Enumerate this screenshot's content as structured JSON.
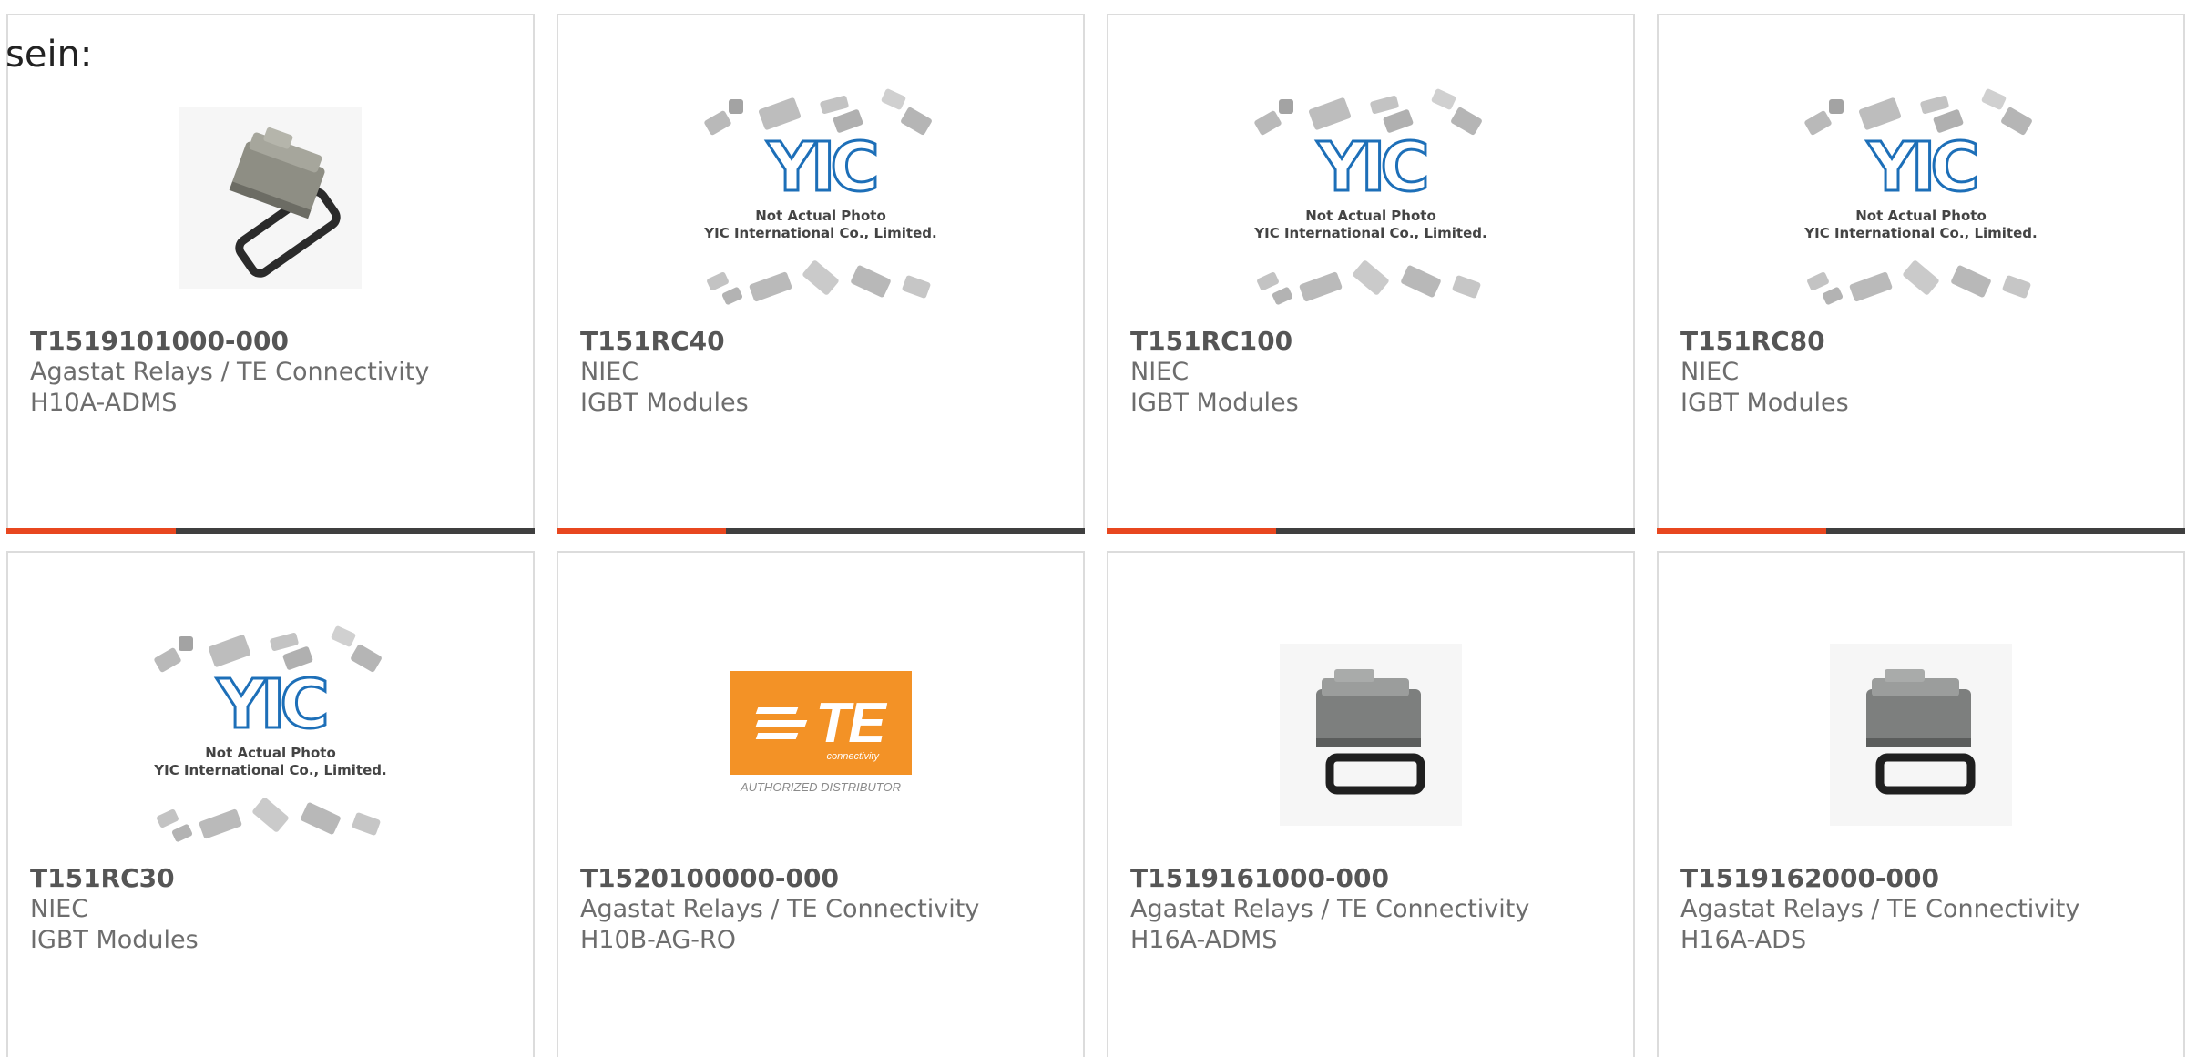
{
  "intro_text": "sein:",
  "colors": {
    "progress_accent": "#e8471f",
    "progress_track": "#3f3f3f",
    "te_orange": "#f39226",
    "yic_blue": "#1d6fb8"
  },
  "products": [
    {
      "part_number": "T1519101000-000",
      "manufacturer": "Agastat Relays / TE Connectivity",
      "category": "H10A-ADMS",
      "image_type": "connector-housing-photo",
      "progress": 0.32
    },
    {
      "part_number": "T151RC40",
      "manufacturer": "NIEC",
      "category": "IGBT Modules",
      "image_type": "yic-placeholder",
      "progress": 0.32
    },
    {
      "part_number": "T151RC100",
      "manufacturer": "NIEC",
      "category": "IGBT Modules",
      "image_type": "yic-placeholder",
      "progress": 0.32
    },
    {
      "part_number": "T151RC80",
      "manufacturer": "NIEC",
      "category": "IGBT Modules",
      "image_type": "yic-placeholder",
      "progress": 0.32
    },
    {
      "part_number": "T151RC30",
      "manufacturer": "NIEC",
      "category": "IGBT Modules",
      "image_type": "yic-placeholder",
      "progress": null
    },
    {
      "part_number": "T1520100000-000",
      "manufacturer": "Agastat Relays / TE Connectivity",
      "category": "H10B-AG-RO",
      "image_type": "te-logo",
      "progress": null
    },
    {
      "part_number": "T1519161000-000",
      "manufacturer": "Agastat Relays / TE Connectivity",
      "category": "H16A-ADMS",
      "image_type": "connector-housing-photo",
      "progress": null
    },
    {
      "part_number": "T1519162000-000",
      "manufacturer": "Agastat Relays / TE Connectivity",
      "category": "H16A-ADS",
      "image_type": "connector-housing-photo",
      "progress": null
    }
  ],
  "yic_placeholder": {
    "logo_text": "YIC",
    "line1": "Not Actual Photo",
    "line2": "YIC International Co., Limited."
  },
  "te_logo": {
    "word": "TE",
    "sub": "connectivity",
    "caption": "AUTHORIZED DISTRIBUTOR"
  }
}
